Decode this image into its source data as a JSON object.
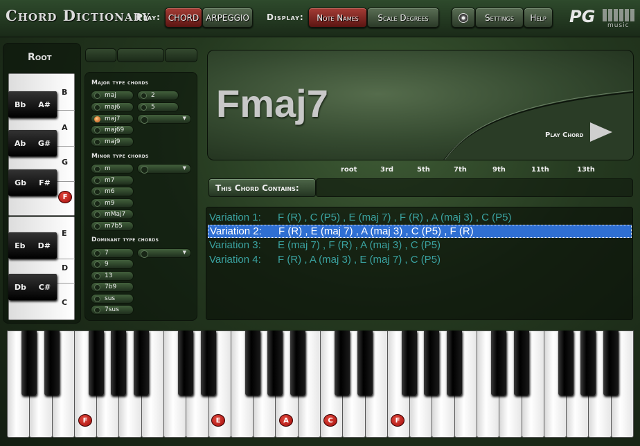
{
  "app_title": "Chord Dictionary",
  "toolbar": {
    "play_label": "Play:",
    "chord": "CHORD",
    "arpeggio": "ARPEGGIO",
    "display_label": "Display:",
    "note_names": "Note Names",
    "scale_degrees": "Scale Degrees",
    "settings": "Settings",
    "help": "Help",
    "logo": "PG",
    "logo_sub": "music"
  },
  "root_panel": {
    "label": "Root",
    "black_keys": [
      {
        "flat": "Bb",
        "sharp": "A#"
      },
      {
        "flat": "Ab",
        "sharp": "G#"
      },
      {
        "flat": "Gb",
        "sharp": "F#"
      },
      {
        "flat": "Eb",
        "sharp": "D#"
      },
      {
        "flat": "Db",
        "sharp": "C#"
      }
    ],
    "white_notes": [
      "B",
      "A",
      "G",
      "F",
      "E",
      "D",
      "C"
    ],
    "selected": "F"
  },
  "chord_types": {
    "major": {
      "header": "Major type chords",
      "items": [
        "maj",
        "maj6",
        "maj7",
        "maj69",
        "maj9"
      ],
      "items2": [
        "2",
        "5"
      ],
      "selected": "maj7"
    },
    "minor": {
      "header": "Minor type chords",
      "items": [
        "m",
        "m7",
        "m6",
        "m9",
        "mMaj7",
        "m7b5"
      ]
    },
    "dominant": {
      "header": "Dominant type chords",
      "items": [
        "7",
        "9",
        "13",
        "7b9",
        "sus",
        "7sus"
      ]
    }
  },
  "display": {
    "chord": "Fmaj7",
    "play_chord": "Play Chord"
  },
  "degrees": [
    "root",
    "3rd",
    "5th",
    "7th",
    "9th",
    "11th",
    "13th"
  ],
  "contains_label": "This Chord Contains:",
  "variations": [
    {
      "label": "Variation 1:",
      "notes": "F (R) , C (P5) , E (maj 7) , F (R) , A (maj 3) , C (P5)"
    },
    {
      "label": "Variation 2:",
      "notes": "F (R) , E (maj 7) , A (maj 3) , C (P5) , F (R)"
    },
    {
      "label": "Variation 3:",
      "notes": "E (maj 7) , F (R) , A (maj 3) , C (P5)"
    },
    {
      "label": "Variation 4:",
      "notes": "F (R) , A (maj 3) , E (maj 7) , C (P5)"
    }
  ],
  "selected_variation": 2,
  "keyboard": {
    "marked_notes": [
      "F",
      "E",
      "A",
      "C",
      "F"
    ]
  }
}
